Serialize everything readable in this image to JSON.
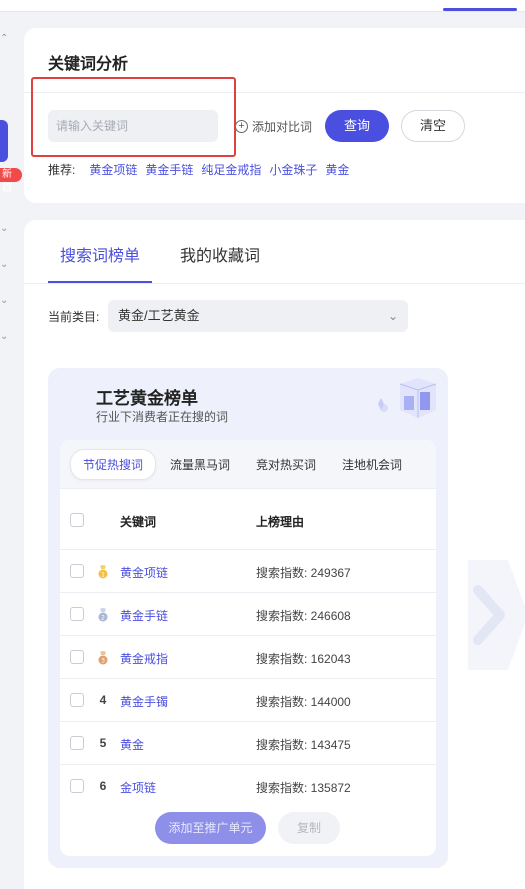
{
  "search_card": {
    "title": "关键词分析",
    "input_placeholder": "请输入关键词",
    "add_compare_label": "添加对比词",
    "query_button": "查询",
    "clear_button": "清空",
    "recommend_label": "推荐:",
    "recommendations": [
      "黄金项链",
      "黄金手链",
      "纯足金戒指",
      "小金珠子",
      "黄金"
    ]
  },
  "left_rail": {
    "badge": "新趋"
  },
  "main_tabs": [
    {
      "label": "搜索词榜单",
      "active": true
    },
    {
      "label": "我的收藏词",
      "active": false
    }
  ],
  "category": {
    "label": "当前类目:",
    "value": "黄金/工艺黄金"
  },
  "ranking": {
    "title": "工艺黄金榜单",
    "subtitle": "行业下消费者正在搜的词",
    "subtabs": [
      {
        "label": "节促热搜词",
        "active": true
      },
      {
        "label": "流量黑马词",
        "active": false
      },
      {
        "label": "竞对热买词",
        "active": false
      },
      {
        "label": "洼地机会词",
        "active": false
      }
    ],
    "columns": {
      "keyword": "关键词",
      "reason": "上榜理由"
    },
    "rows": [
      {
        "rank": "1",
        "medal": "gold",
        "keyword": "黄金项链",
        "reason": "搜索指数: 249367"
      },
      {
        "rank": "2",
        "medal": "silver",
        "keyword": "黄金手链",
        "reason": "搜索指数: 246608"
      },
      {
        "rank": "3",
        "medal": "bronze",
        "keyword": "黄金戒指",
        "reason": "搜索指数: 162043"
      },
      {
        "rank": "4",
        "medal": "",
        "keyword": "黄金手镯",
        "reason": "搜索指数: 144000"
      },
      {
        "rank": "5",
        "medal": "",
        "keyword": "黄金",
        "reason": "搜索指数: 143475"
      },
      {
        "rank": "6",
        "medal": "",
        "keyword": "金项链",
        "reason": "搜索指数: 135872"
      }
    ],
    "add_button": "添加至推广单元",
    "copy_button": "复制"
  },
  "colors": {
    "accent": "#4a4fe0",
    "highlight_box": "#e04040",
    "badge": "#f04a4a"
  }
}
